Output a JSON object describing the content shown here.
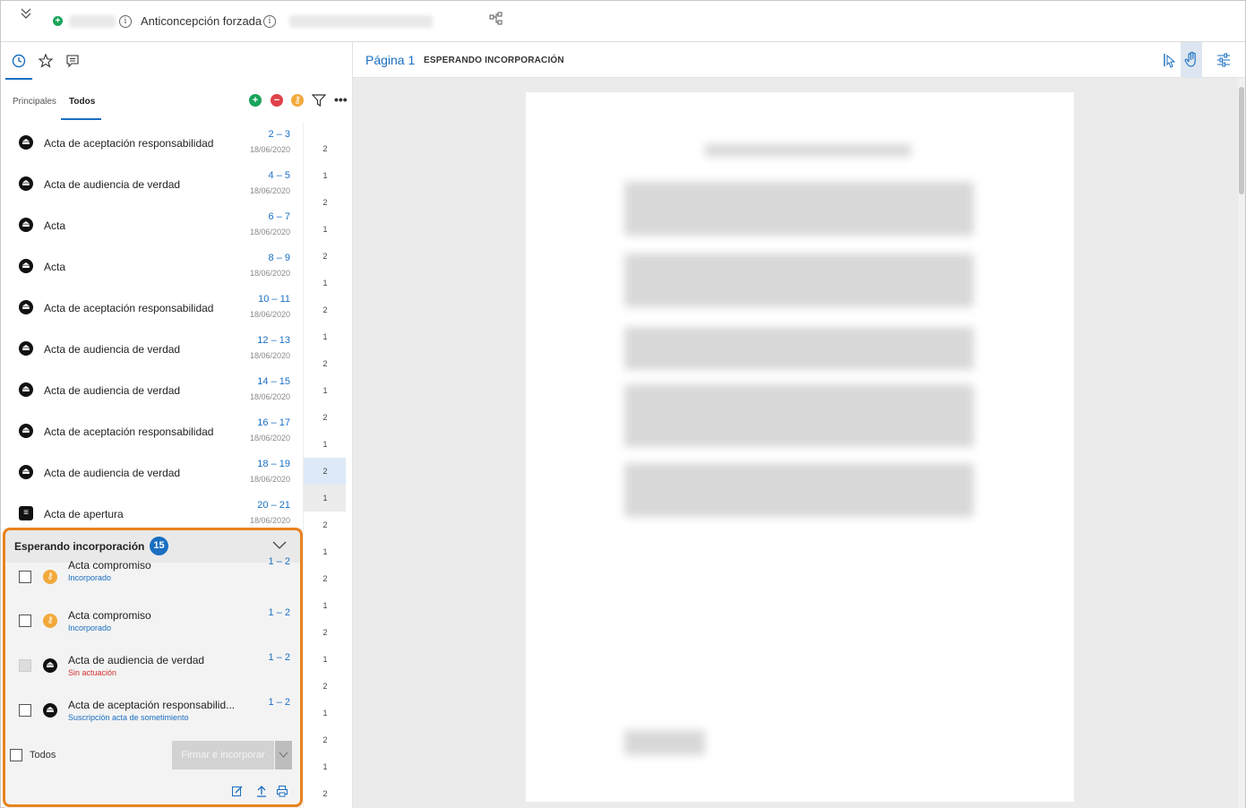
{
  "header": {
    "title": "Anticoncepción forzada"
  },
  "left_tabs": {
    "sub_tabs": [
      "Principales",
      "Todos"
    ],
    "active_sub_tab": "Todos"
  },
  "documents": [
    {
      "title": "Acta de aceptación responsabilidad",
      "range": "2 – 3",
      "date": "18/06/2020",
      "icon": "stamp-icon"
    },
    {
      "title": "Acta de audiencia de verdad",
      "range": "4 – 5",
      "date": "18/06/2020",
      "icon": "stamp-icon"
    },
    {
      "title": "Acta",
      "range": "6 – 7",
      "date": "18/06/2020",
      "icon": "stamp-icon"
    },
    {
      "title": "Acta",
      "range": "8 – 9",
      "date": "18/06/2020",
      "icon": "stamp-icon"
    },
    {
      "title": "Acta de aceptación responsabilidad",
      "range": "10 – 11",
      "date": "18/06/2020",
      "icon": "stamp-icon"
    },
    {
      "title": "Acta de audiencia de verdad",
      "range": "12 – 13",
      "date": "18/06/2020",
      "icon": "stamp-icon"
    },
    {
      "title": "Acta de audiencia de verdad",
      "range": "14 – 15",
      "date": "18/06/2020",
      "icon": "stamp-icon"
    },
    {
      "title": "Acta de aceptación responsabilidad",
      "range": "16 – 17",
      "date": "18/06/2020",
      "icon": "stamp-icon"
    },
    {
      "title": "Acta de audiencia de verdad",
      "range": "18 – 19",
      "date": "18/06/2020",
      "icon": "stamp-icon"
    },
    {
      "title": "Acta de apertura",
      "range": "20 – 21",
      "date": "18/06/2020",
      "icon": "document-icon"
    }
  ],
  "page_strip": [
    "1",
    "2",
    "1",
    "2",
    "1",
    "2",
    "1",
    "2",
    "1",
    "2",
    "1",
    "2",
    "1",
    "2",
    "1",
    "2",
    "1",
    "2",
    "1",
    "2",
    "1",
    "2",
    "1",
    "2",
    "1",
    "2"
  ],
  "waiting": {
    "title": "Esperando incorporación",
    "count": "15",
    "items": [
      {
        "title": "Acta compromiso",
        "status": "Incorporado",
        "range": "1 – 2",
        "status_color": "#1a6fc2",
        "icon_color": "#f2a93b",
        "icon": "key-icon",
        "disabled": false
      },
      {
        "title": "Acta compromiso",
        "status": "Incorporado",
        "range": "1 – 2",
        "status_color": "#1a6fc2",
        "icon_color": "#f2a93b",
        "icon": "key-icon",
        "disabled": false
      },
      {
        "title": "Acta de audiencia de verdad",
        "status": "Sin actuación",
        "range": "1 – 2",
        "status_color": "#d23030",
        "icon_color": "#111111",
        "icon": "stamp-icon",
        "disabled": true
      },
      {
        "title": "Acta de aceptación responsabilid...",
        "status": "Suscripción acta de sometimiento",
        "range": "1 – 2",
        "status_color": "#1a6fc2",
        "icon_color": "#111111",
        "icon": "stamp-icon",
        "disabled": false
      }
    ],
    "all_label": "Todos",
    "sign_button": "Firmar e incorporar"
  },
  "viewer": {
    "page_label": "Página 1",
    "status": "ESPERANDO INCORPORACIÓN"
  },
  "colors": {
    "accent": "#1a6fc2",
    "highlight": "#e8821e",
    "add": "#19a35b",
    "remove": "#e0424a",
    "key": "#f2a93b"
  }
}
